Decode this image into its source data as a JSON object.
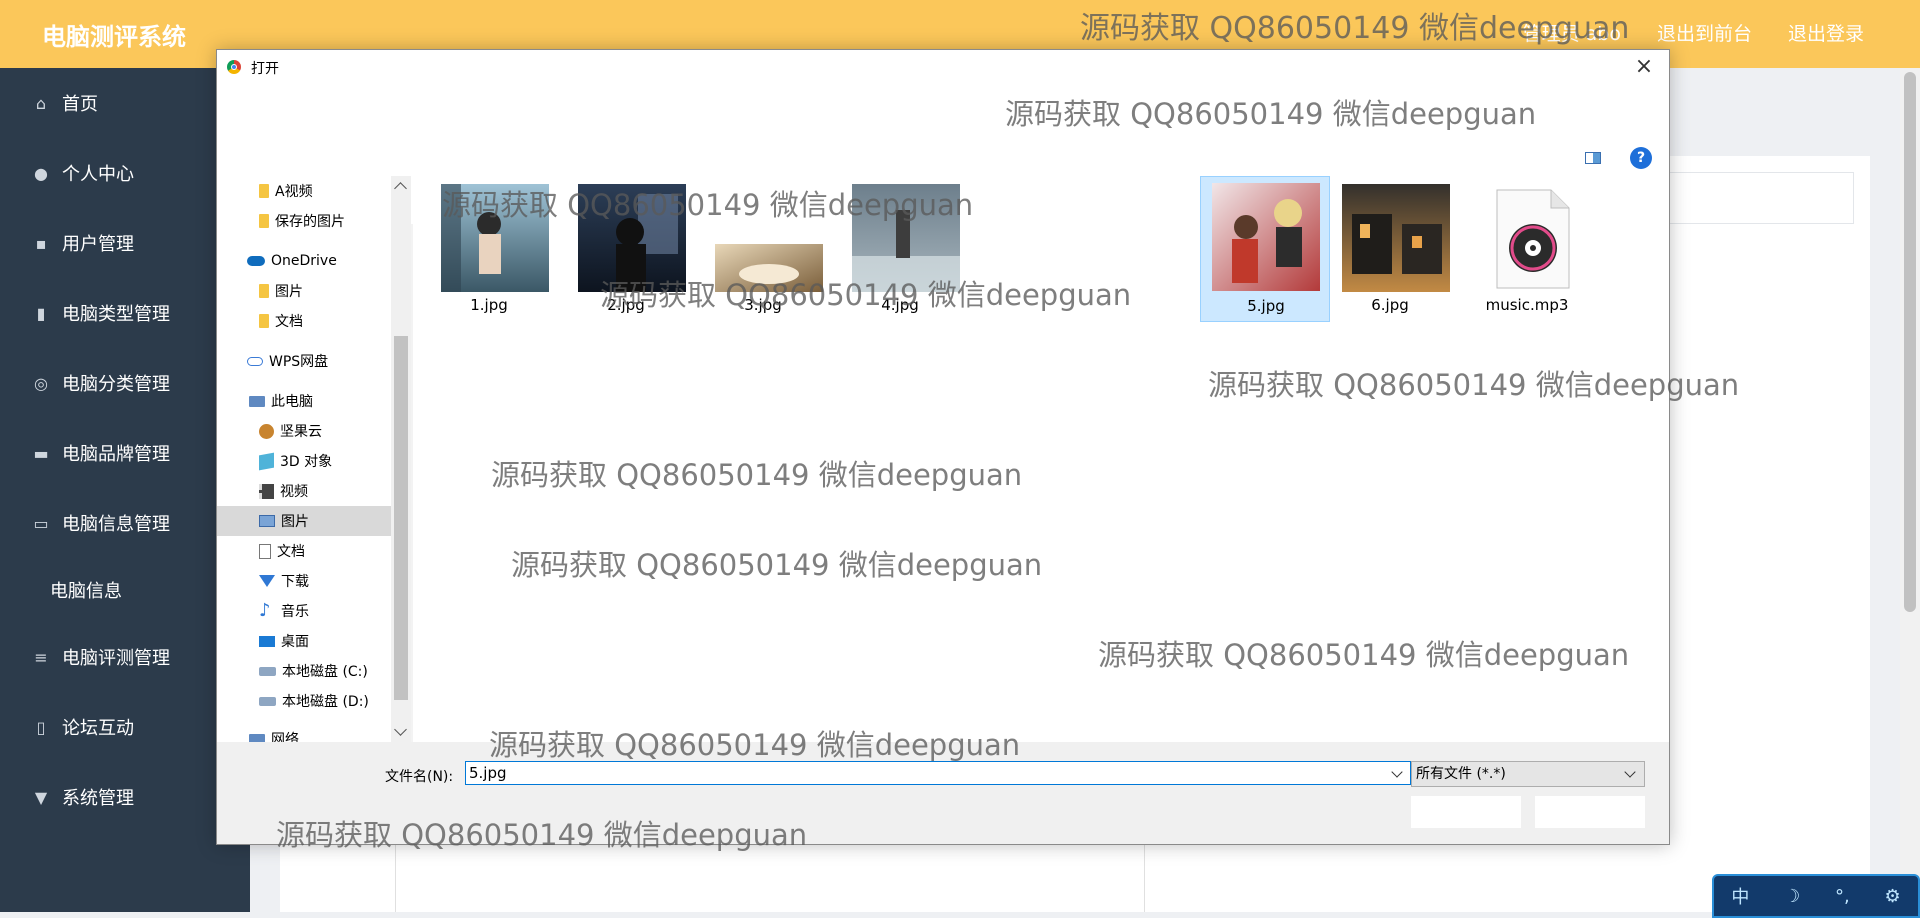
{
  "app": {
    "brand": "电脑测评系统",
    "top_links": [
      "管理员 abo",
      "退出到前台",
      "退出登录"
    ]
  },
  "sidebar": {
    "items": [
      {
        "label": "首页",
        "icon": "home-icon"
      },
      {
        "label": "个人中心",
        "icon": "user-icon"
      },
      {
        "label": "用户管理",
        "icon": "chat-icon"
      },
      {
        "label": "电脑类型管理",
        "icon": "clipboard-icon"
      },
      {
        "label": "电脑分类管理",
        "icon": "bell-off-icon"
      },
      {
        "label": "电脑品牌管理",
        "icon": "briefcase-icon"
      },
      {
        "label": "电脑信息管理",
        "icon": "card-icon"
      },
      {
        "label": "电脑信息",
        "sub": true
      },
      {
        "label": "电脑评测管理",
        "icon": "list-icon"
      },
      {
        "label": "论坛互动",
        "icon": "mic-icon"
      },
      {
        "label": "系统管理",
        "icon": "trophy-icon"
      }
    ]
  },
  "dialog": {
    "title": "打开",
    "close": "×",
    "help": "?",
    "nav": [
      {
        "label": "A视频",
        "icon": "folder-icon"
      },
      {
        "label": "保存的图片",
        "icon": "folder-icon"
      },
      {
        "label": "OneDrive",
        "icon": "onedrive-icon"
      },
      {
        "label": "图片",
        "icon": "folder-icon"
      },
      {
        "label": "文档",
        "icon": "folder-icon"
      },
      {
        "label": "WPS网盘",
        "icon": "wps-cloud-icon"
      },
      {
        "label": "此电脑",
        "icon": "pc-icon"
      },
      {
        "label": "坚果云",
        "icon": "nut-icon"
      },
      {
        "label": "3D 对象",
        "icon": "cube-icon"
      },
      {
        "label": "视频",
        "icon": "film-icon"
      },
      {
        "label": "图片",
        "icon": "picture-icon",
        "selected": true
      },
      {
        "label": "文档",
        "icon": "document-icon"
      },
      {
        "label": "下载",
        "icon": "download-icon"
      },
      {
        "label": "音乐",
        "icon": "music-icon"
      },
      {
        "label": "桌面",
        "icon": "desktop-icon"
      },
      {
        "label": "本地磁盘 (C:)",
        "icon": "disk-icon"
      },
      {
        "label": "本地磁盘 (D:)",
        "icon": "disk-icon"
      },
      {
        "label": "网络",
        "icon": "network-icon"
      }
    ],
    "files": [
      {
        "name": "1.jpg",
        "colors": [
          "#9fc3d6",
          "#3b5866"
        ]
      },
      {
        "name": "2.jpg",
        "colors": [
          "#2c3e57",
          "#0d141f"
        ]
      },
      {
        "name": "3.jpg",
        "colors": [
          "#e8d7b8",
          "#7a5e3a"
        ]
      },
      {
        "name": "4.jpg",
        "colors": [
          "#6d7f8c",
          "#a7b5bd"
        ]
      },
      {
        "name": "5.jpg",
        "colors": [
          "#f1e6e8",
          "#b33a3a"
        ],
        "selected": true
      },
      {
        "name": "6.jpg",
        "colors": [
          "#33302c",
          "#c28a44"
        ]
      },
      {
        "name": "music.mp3",
        "type": "audio"
      }
    ],
    "filename_label": "文件名(N):",
    "filename_value": "5.jpg",
    "filetype_value": "所有文件 (*.*)"
  },
  "ime": {
    "labels": [
      "中",
      "☽",
      "°,",
      "⚙"
    ]
  },
  "watermark": "源码获取 QQ86050149 微信deepguan"
}
